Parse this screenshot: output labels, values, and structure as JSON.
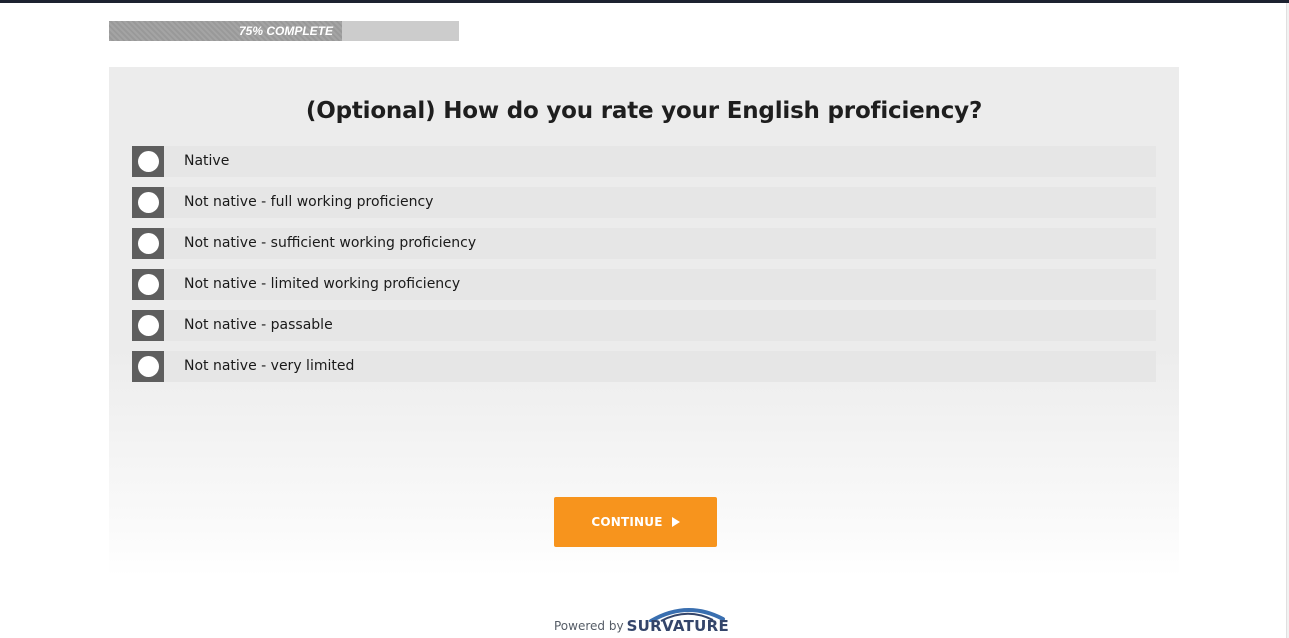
{
  "progress": {
    "label": "75% COMPLETE",
    "value": 0.75
  },
  "question": {
    "title": "(Optional) How do you rate your English proficiency?"
  },
  "options": [
    {
      "label": "Native"
    },
    {
      "label": "Not native - full working proficiency"
    },
    {
      "label": "Not native - sufficient working proficiency"
    },
    {
      "label": "Not native - limited working proficiency"
    },
    {
      "label": "Not native - passable"
    },
    {
      "label": "Not native - very limited"
    }
  ],
  "continue_button": {
    "label": "CONTINUE",
    "icon": "play-icon"
  },
  "footer": {
    "powered_by": "Powered by",
    "brand": "SURVATURE"
  },
  "colors": {
    "accent": "#f7941d",
    "brand": "#34456a",
    "radio": "#5e5e5e"
  }
}
